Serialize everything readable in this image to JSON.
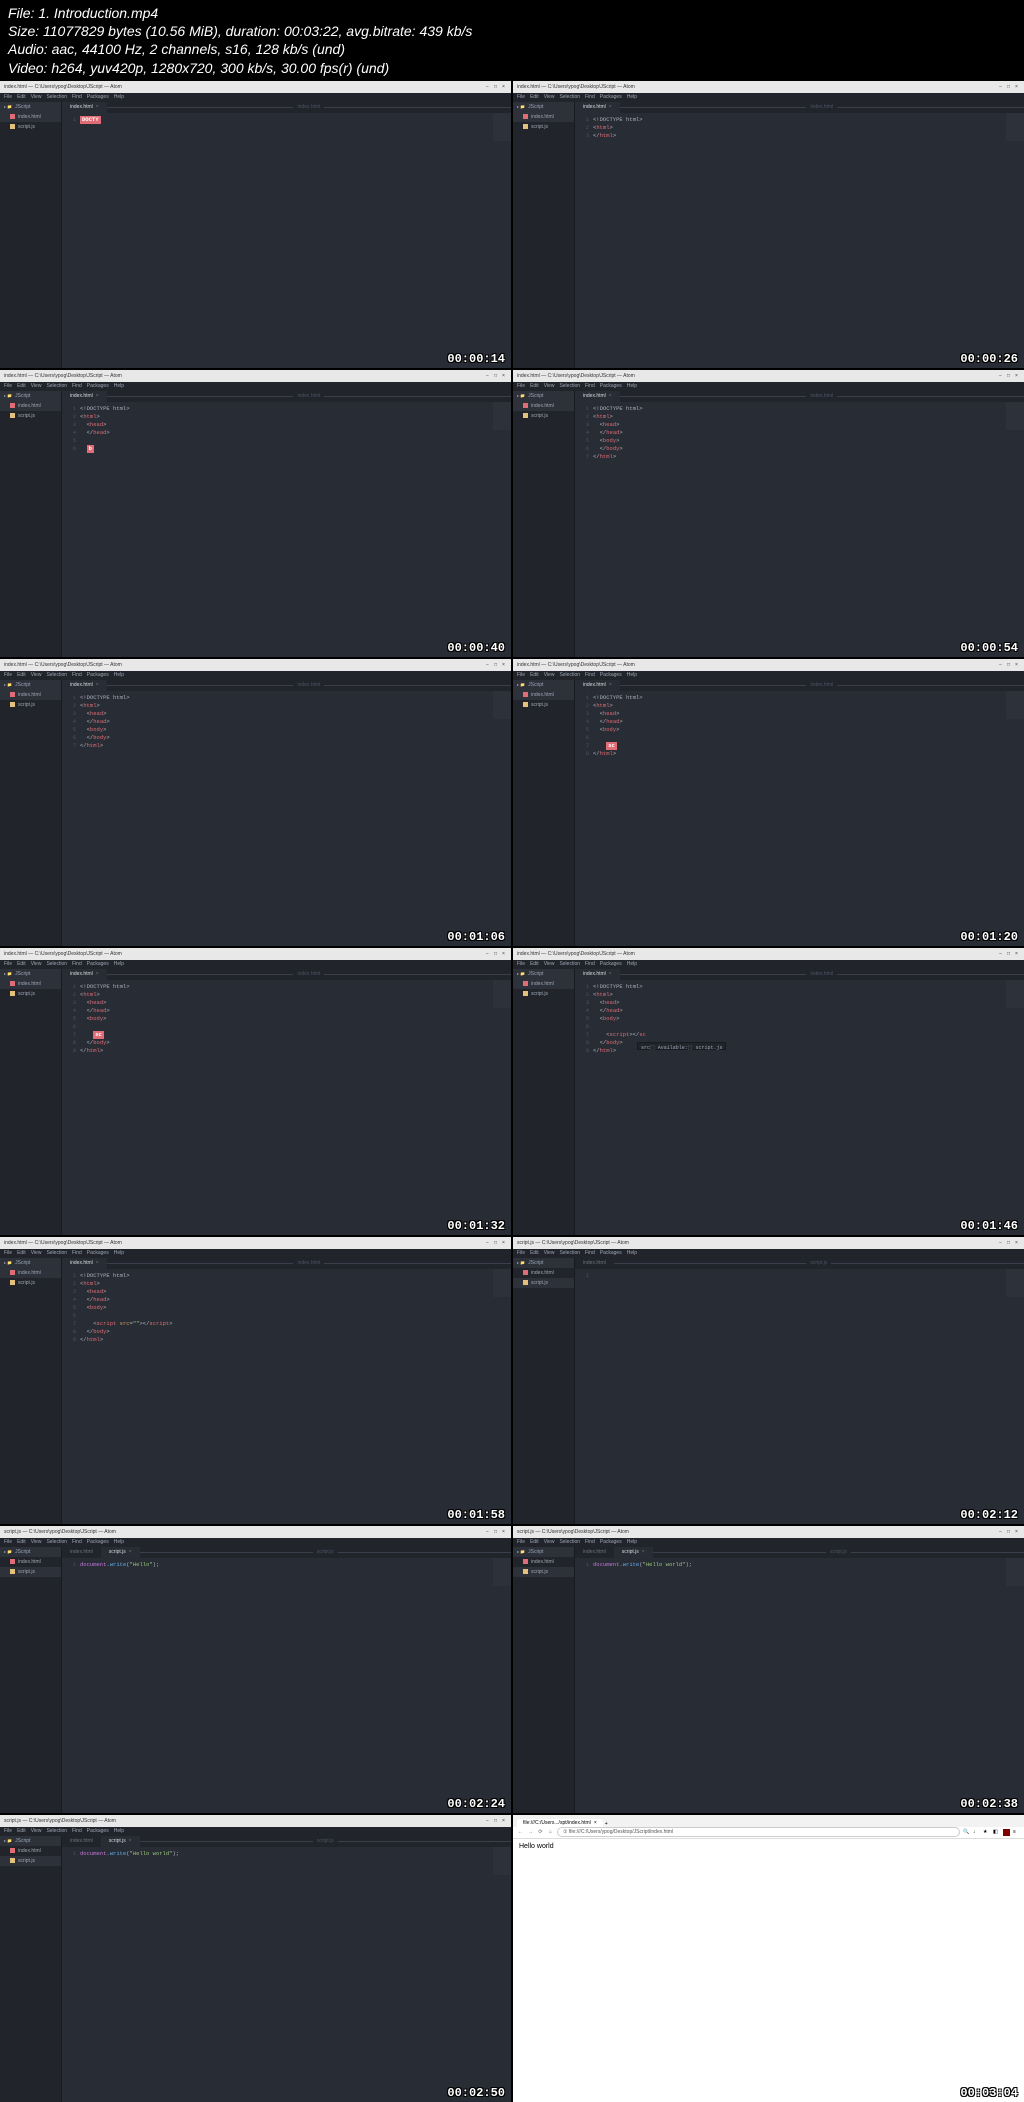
{
  "header": {
    "file_line": "File: 1. Introduction.mp4",
    "size_line": "Size: 11077829 bytes (10.56 MiB), duration: 00:03:22, avg.bitrate: 439 kb/s",
    "audio_line": "Audio: aac, 44100 Hz, 2 channels, s16, 128 kb/s (und)",
    "video_line": "Video: h264, yuv420p, 1280x720, 300 kb/s, 30.00 fps(r) (und)"
  },
  "common": {
    "window_title": "index.html — C:\\Users\\ypog\\Desktop\\JScript — Atom",
    "window_title_js": "script.js — C:\\Users\\ypog\\Desktop\\JScript — Atom",
    "menu": [
      "File",
      "Edit",
      "View",
      "Selection",
      "Find",
      "Packages",
      "Help"
    ],
    "project": "JScript",
    "tree_index": "index.html",
    "tree_script": "script.js",
    "tab_index": "index.html",
    "tab_script": "script.js",
    "doctype": "<!DOCTYPE html>",
    "html_open": "<html>",
    "html_close": "</html>",
    "head_open": "<head>",
    "head_close": "</head>",
    "body_open": "<body>",
    "body_close": "</body>"
  },
  "frames": [
    {
      "ts": "00:00:14",
      "type": "atom",
      "active": "index.html",
      "single_line": true,
      "ac": "DOCTY"
    },
    {
      "ts": "00:00:26",
      "type": "atom",
      "active": "index.html",
      "lines": [
        "doctype",
        "html_open",
        "html_close"
      ]
    },
    {
      "ts": "00:00:40",
      "type": "atom",
      "active": "index.html",
      "lines": [
        "doctype",
        "html_open",
        "head_open",
        "head_close",
        "",
        "b_ac"
      ],
      "ac": "b"
    },
    {
      "ts": "00:00:54",
      "type": "atom",
      "active": "index.html",
      "lines": [
        "doctype",
        "html_open",
        "head_open",
        "head_close",
        "body_open",
        "body_close",
        "html_close"
      ]
    },
    {
      "ts": "00:01:06",
      "type": "atom",
      "active": "index.html",
      "lines": [
        "doctype",
        "html_open",
        "head_open",
        "head_close",
        "body_open",
        "body_close",
        "html_close"
      ]
    },
    {
      "ts": "00:01:20",
      "type": "atom",
      "active": "index.html",
      "lines": [
        "doctype",
        "html_open",
        "head_open",
        "head_close",
        "body_open",
        "",
        "sc_ac",
        "html_close"
      ],
      "ac": "sc"
    },
    {
      "ts": "00:01:32",
      "type": "atom",
      "active": "index.html",
      "lines": [
        "doctype",
        "html_open",
        "head_open",
        "head_close",
        "body_open",
        "",
        "sc_ac",
        "body_close",
        "html_close"
      ],
      "ac": "sc"
    },
    {
      "ts": "00:01:46",
      "type": "atom",
      "active": "index.html",
      "lines": [
        "doctype",
        "html_open",
        "head_open",
        "head_close",
        "body_open",
        "",
        "script_tag_auto",
        "body_close",
        "html_close"
      ],
      "popup": {
        "text": "src⬚ Available:⬚ script.js",
        "below": "script_tag_auto"
      }
    },
    {
      "ts": "00:01:58",
      "type": "atom",
      "active": "index.html",
      "lines": [
        "doctype",
        "html_open",
        "head_open",
        "head_close",
        "body_open",
        "",
        "script_tag_src",
        "body_close",
        "html_close"
      ]
    },
    {
      "ts": "00:02:12",
      "type": "atom",
      "active": "script.js",
      "empty": true
    },
    {
      "ts": "00:02:24",
      "type": "atom",
      "active": "script.js",
      "js_line": "document.write(\"Hello\");",
      "partial": true
    },
    {
      "ts": "00:02:38",
      "type": "atom",
      "active": "script.js",
      "js_line": "document.write(\"Hello world\");"
    },
    {
      "ts": "00:02:50",
      "type": "atom",
      "active": "script.js",
      "js_line": "document.write(\"Hello world\");",
      "cursor_in": true
    },
    {
      "ts": "00:03:04",
      "type": "browser",
      "url": "file:///C:/Users/ypog/Desktop/JScript/index.html",
      "tab": "file:///C:/Users.../spt/index.html",
      "content": "Hello world"
    }
  ]
}
